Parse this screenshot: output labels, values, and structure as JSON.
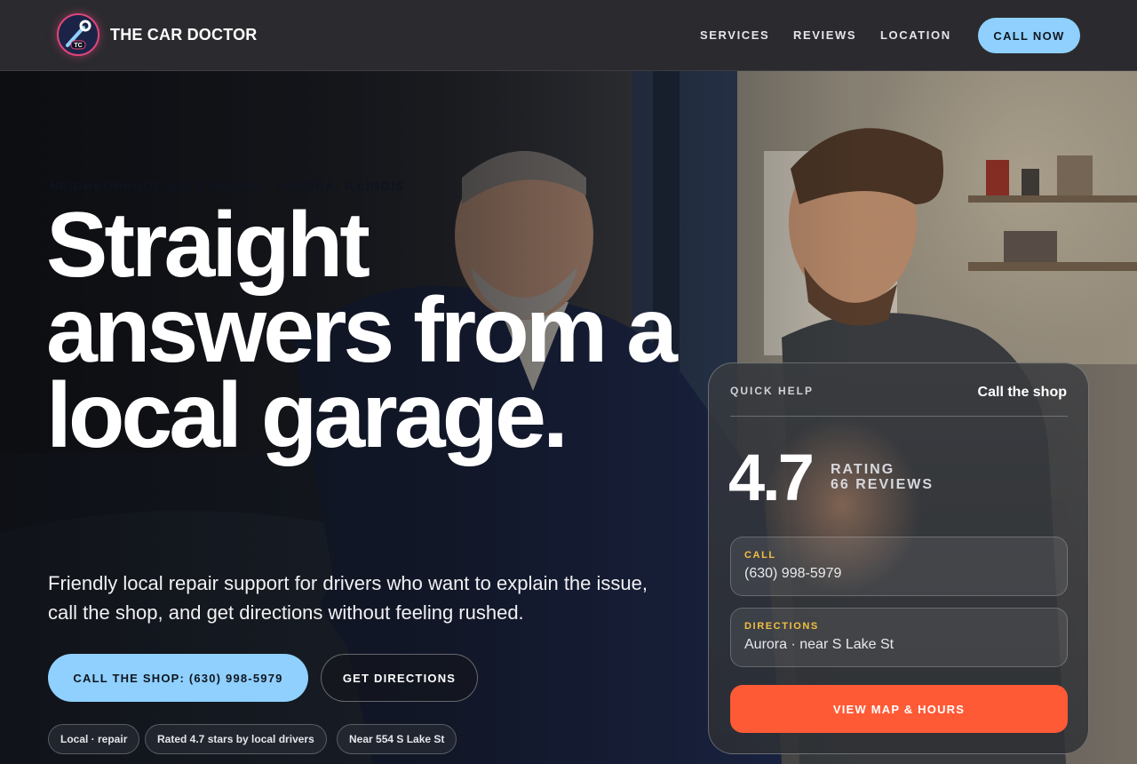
{
  "header": {
    "brand": "THE CAR DOCTOR",
    "logo_initials": "TC",
    "nav": [
      {
        "label": "SERVICES"
      },
      {
        "label": "REVIEWS"
      },
      {
        "label": "LOCATION"
      }
    ],
    "cta": "CALL NOW"
  },
  "hero": {
    "eyebrow": "NEIGHBORHOOD AUTO REPAIR · AURORA, ILLINOIS",
    "headline": "Straight answers from a local garage.",
    "subcopy": "Friendly local repair support for drivers who want to explain the issue, call the shop, and get directions without feeling rushed.",
    "primary_button": "CALL THE SHOP: (630) 998-5979",
    "secondary_button": "GET DIRECTIONS",
    "chips": [
      {
        "label": "Local · repair"
      },
      {
        "label": "Rated 4.7 stars by local drivers"
      },
      {
        "label": "Near 554 S Lake St"
      }
    ]
  },
  "quick_help": {
    "kicker": "QUICK HELP",
    "link": "Call the shop",
    "rating": "4.7",
    "rating_label": "RATING",
    "reviews_label": "66 REVIEWS",
    "call": {
      "label": "CALL",
      "value": "(630) 998-5979"
    },
    "directions": {
      "label": "DIRECTIONS",
      "value": "Aurora · near S Lake St"
    },
    "button": "VIEW MAP & HOURS"
  },
  "colors": {
    "accent_blue": "#8fd0ff",
    "accent_orange": "#ff5a36",
    "label_gold": "#f2c040",
    "header_bg": "#2b2b2f"
  }
}
